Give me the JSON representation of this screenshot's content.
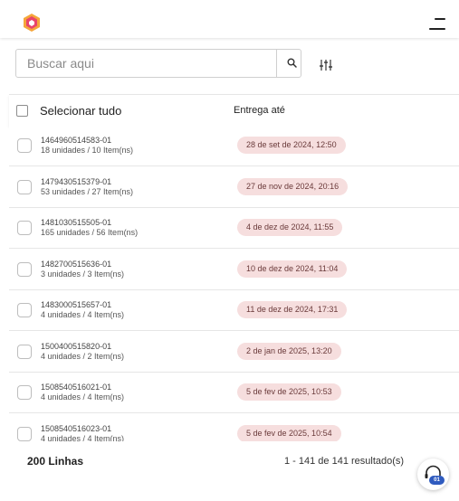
{
  "header": {
    "logo_icon": "app-logo-icon",
    "menu_icon": "menu-icon"
  },
  "search": {
    "placeholder": "Buscar aqui",
    "value": ""
  },
  "list": {
    "select_all_label": "Selecionar tudo",
    "delivery_header": "Entrega até",
    "rows": [
      {
        "id": "1464960514583-01",
        "summary": "18 unidades / 10 Item(ns)",
        "delivery": "28 de set de 2024, 12:50"
      },
      {
        "id": "1479430515379-01",
        "summary": "53 unidades / 27 Item(ns)",
        "delivery": "27 de nov de 2024, 20:16"
      },
      {
        "id": "1481030515505-01",
        "summary": "165 unidades / 56 Item(ns)",
        "delivery": "4 de dez de 2024, 11:55"
      },
      {
        "id": "1482700515636-01",
        "summary": "3 unidades / 3 Item(ns)",
        "delivery": "10 de dez de 2024, 11:04"
      },
      {
        "id": "1483000515657-01",
        "summary": "4 unidades / 4 Item(ns)",
        "delivery": "11 de dez de 2024, 17:31"
      },
      {
        "id": "1500400515820-01",
        "summary": "4 unidades / 2 Item(ns)",
        "delivery": "2 de jan de 2025, 13:20"
      },
      {
        "id": "1508540516021-01",
        "summary": "4 unidades / 4 Item(ns)",
        "delivery": "5 de fev de 2025, 10:53"
      },
      {
        "id": "1508540516023-01",
        "summary": "4 unidades / 4 Item(ns)",
        "delivery": "5 de fev de 2025, 10:54"
      }
    ]
  },
  "footer": {
    "rows_label": "200 Linhas",
    "results_label": "1 - 141 de 141 resultado(s)",
    "chat_badge": "01"
  },
  "colors": {
    "badge_bg": "#f6dede",
    "badge_text": "#6a3a3a",
    "logo_primary": "#e8456b",
    "logo_secondary": "#f5a63a",
    "chat_badge": "#2f5bbf"
  }
}
